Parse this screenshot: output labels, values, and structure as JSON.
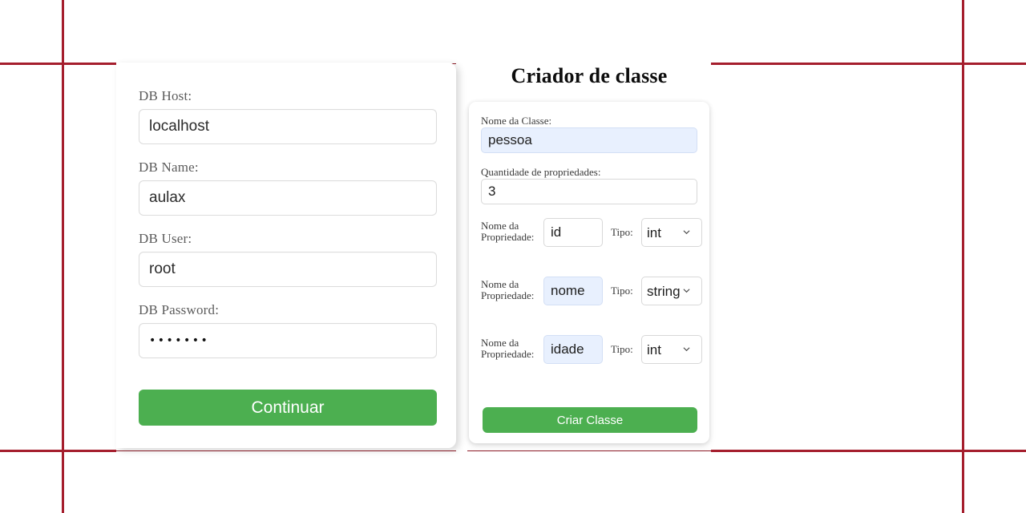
{
  "colors": {
    "guide_line": "#a51e2d",
    "button_green": "#4caf50",
    "autofill_blue": "#e8f0fe",
    "page_background": "#ffffff"
  },
  "db_form": {
    "fields": [
      {
        "label": "DB Host:",
        "value": "localhost",
        "type": "text"
      },
      {
        "label": "DB Name:",
        "value": "aulax",
        "type": "text"
      },
      {
        "label": "DB User:",
        "value": "root",
        "type": "text"
      },
      {
        "label": "DB Password:",
        "value": "•••••••",
        "type": "password"
      }
    ],
    "submit_label": "Continuar"
  },
  "class_creator": {
    "title": "Criador de classe",
    "class_name_label": "Nome da Classe:",
    "class_name_value": "pessoa",
    "prop_count_label": "Quantidade de propriedades:",
    "prop_count_value": "3",
    "property_label": "Nome da Propriedade:",
    "type_label": "Tipo:",
    "type_options": [
      "int",
      "string"
    ],
    "properties": [
      {
        "name": "id",
        "type": "int",
        "autofilled": false
      },
      {
        "name": "nome",
        "type": "string",
        "autofilled": true
      },
      {
        "name": "idade",
        "type": "int",
        "autofilled": true
      }
    ],
    "submit_label": "Criar Classe"
  }
}
